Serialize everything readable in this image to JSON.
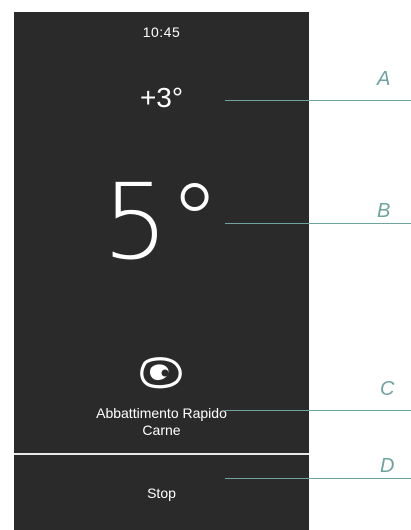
{
  "status": {
    "time": "10:45"
  },
  "display": {
    "setpoint_temp": "+3°",
    "core_temp": "5°"
  },
  "program": {
    "icon": "steak-icon",
    "name_line1": "Abbattimento Rapido",
    "name_line2": "Carne"
  },
  "actions": {
    "stop_label": "Stop"
  },
  "callouts": {
    "a": "A",
    "b": "B",
    "c": "C",
    "d": "D"
  },
  "colors": {
    "panel": "#2a2a2a",
    "text": "#ffffff",
    "callout": "#6fa3a0"
  }
}
